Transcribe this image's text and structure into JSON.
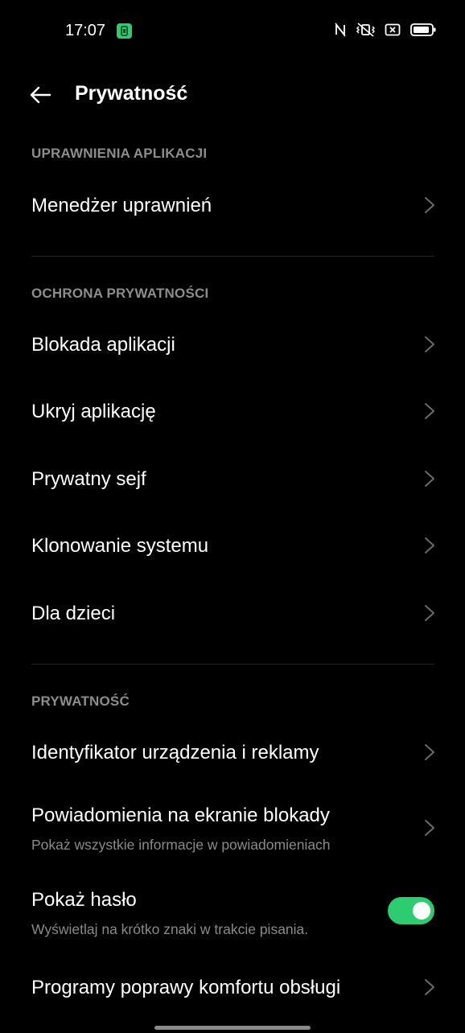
{
  "status_bar": {
    "time": "17:07",
    "icons": [
      "app-notification-icon",
      "nfc-icon",
      "vibrate-icon",
      "no-sim-icon",
      "battery-icon"
    ]
  },
  "header": {
    "back_icon": "arrow-left-icon",
    "title": "Prywatność"
  },
  "sections": {
    "app_permissions": {
      "header": "UPRAWNIENIA APLIKACJI",
      "items": [
        {
          "label": "Menedżer uprawnień"
        }
      ]
    },
    "privacy_protection": {
      "header": "OCHRONA PRYWATNOŚCI",
      "items": [
        {
          "label": "Blokada aplikacji"
        },
        {
          "label": "Ukryj aplikację"
        },
        {
          "label": "Prywatny sejf"
        },
        {
          "label": "Klonowanie systemu"
        },
        {
          "label": "Dla dzieci"
        }
      ]
    },
    "privacy": {
      "header": "PRYWATNOŚĆ",
      "items": [
        {
          "label": "Identyfikator urządzenia i reklamy"
        },
        {
          "label": "Powiadomienia na ekranie blokady",
          "subtitle": "Pokaż wszystkie informacje w powiadomieniach"
        },
        {
          "label": "Pokaż hasło",
          "subtitle": "Wyświetlaj na krótko znaki w trakcie pisania.",
          "toggle_on": true
        },
        {
          "label": "Programy poprawy komfortu obsługi"
        }
      ]
    }
  },
  "colors": {
    "background": "#000000",
    "accent": "#2ecc71",
    "section_header": "#8d8d8d",
    "subtitle": "#8a8a8a"
  }
}
